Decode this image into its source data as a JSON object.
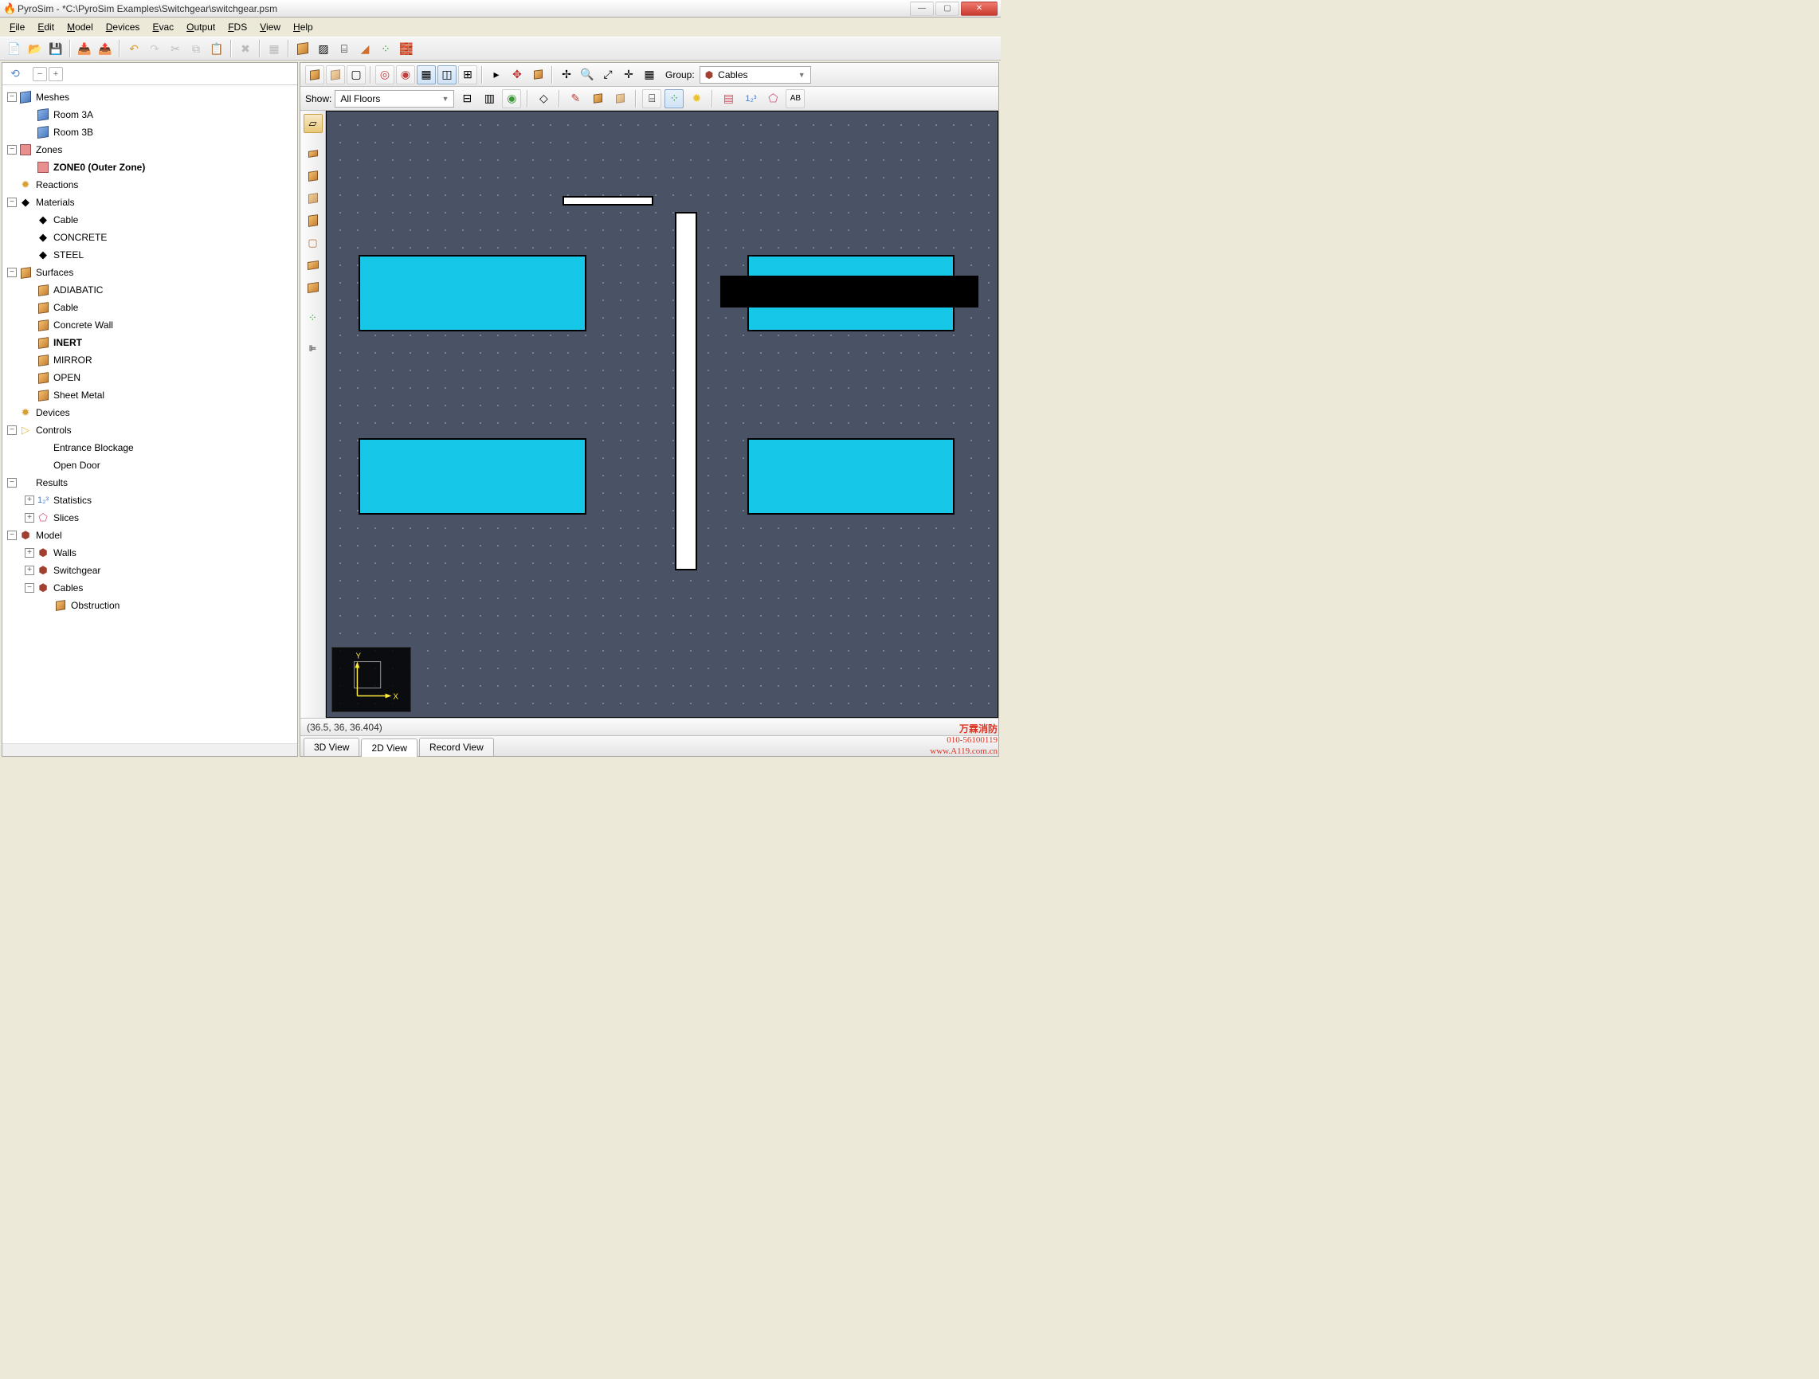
{
  "window": {
    "title": "PyroSim - *C:\\PyroSim Examples\\Switchgear\\switchgear.psm"
  },
  "menubar": [
    "File",
    "Edit",
    "Model",
    "Devices",
    "Evac",
    "Output",
    "FDS",
    "View",
    "Help"
  ],
  "group": {
    "label": "Group:",
    "value": "Cables"
  },
  "show": {
    "label": "Show:",
    "value": "All Floors"
  },
  "tree": [
    {
      "d": 0,
      "exp": "-",
      "icon": "mesh",
      "label": "Meshes"
    },
    {
      "d": 1,
      "exp": "",
      "icon": "mesh",
      "label": "Room 3A"
    },
    {
      "d": 1,
      "exp": "",
      "icon": "mesh",
      "label": "Room 3B"
    },
    {
      "d": 0,
      "exp": "-",
      "icon": "zone",
      "label": "Zones"
    },
    {
      "d": 1,
      "exp": "",
      "icon": "zone",
      "label": "ZONE0 (Outer Zone)",
      "bold": true
    },
    {
      "d": 0,
      "exp": "",
      "icon": "react",
      "label": "Reactions"
    },
    {
      "d": 0,
      "exp": "-",
      "icon": "mat",
      "label": "Materials"
    },
    {
      "d": 1,
      "exp": "",
      "icon": "mat",
      "label": "Cable"
    },
    {
      "d": 1,
      "exp": "",
      "icon": "mat",
      "label": "CONCRETE"
    },
    {
      "d": 1,
      "exp": "",
      "icon": "mat",
      "label": "STEEL"
    },
    {
      "d": 0,
      "exp": "-",
      "icon": "surf",
      "label": "Surfaces"
    },
    {
      "d": 1,
      "exp": "",
      "icon": "surf",
      "label": "ADIABATIC"
    },
    {
      "d": 1,
      "exp": "",
      "icon": "surf",
      "label": "Cable"
    },
    {
      "d": 1,
      "exp": "",
      "icon": "surf",
      "label": "Concrete Wall"
    },
    {
      "d": 1,
      "exp": "",
      "icon": "surf",
      "label": "INERT",
      "bold": true
    },
    {
      "d": 1,
      "exp": "",
      "icon": "surf",
      "label": "MIRROR"
    },
    {
      "d": 1,
      "exp": "",
      "icon": "surf",
      "label": "OPEN"
    },
    {
      "d": 1,
      "exp": "",
      "icon": "surf",
      "label": "Sheet Metal"
    },
    {
      "d": 0,
      "exp": "",
      "icon": "dev",
      "label": "Devices"
    },
    {
      "d": 0,
      "exp": "-",
      "icon": "ctrl",
      "label": "Controls"
    },
    {
      "d": 1,
      "exp": "",
      "icon": "none",
      "label": "Entrance Blockage"
    },
    {
      "d": 1,
      "exp": "",
      "icon": "none",
      "label": "Open Door"
    },
    {
      "d": 0,
      "exp": "-",
      "icon": "res",
      "label": "Results"
    },
    {
      "d": 1,
      "exp": "+",
      "icon": "stat",
      "label": "Statistics"
    },
    {
      "d": 1,
      "exp": "+",
      "icon": "slice",
      "label": "Slices"
    },
    {
      "d": 0,
      "exp": "-",
      "icon": "model",
      "label": "Model"
    },
    {
      "d": 1,
      "exp": "+",
      "icon": "model",
      "label": "Walls"
    },
    {
      "d": 1,
      "exp": "+",
      "icon": "model",
      "label": "Switchgear"
    },
    {
      "d": 1,
      "exp": "-",
      "icon": "model",
      "label": "Cables"
    },
    {
      "d": 2,
      "exp": "",
      "icon": "obst",
      "label": "Obstruction"
    }
  ],
  "status": {
    "coords": "(36.5, 36, 36.404)"
  },
  "viewtabs": [
    {
      "label": "3D View",
      "active": false
    },
    {
      "label": "2D View",
      "active": true
    },
    {
      "label": "Record View",
      "active": false
    }
  ],
  "watermark": {
    "l1": "万霖消防",
    "l2": "010-56100119",
    "l3": "www.A119.com.cn"
  },
  "axis": {
    "x": "X",
    "y": "Y"
  },
  "toolbar_icons": {
    "new": "📄",
    "open": "📂",
    "save": "💾",
    "import": "📥",
    "export": "📤",
    "undo": "↶",
    "redo": "↷",
    "cut": "✂",
    "copy": "⧉",
    "paste": "📋",
    "delete": "✖",
    "group": "▦",
    "box": "◫",
    "mesh": "▨",
    "props": "⌸",
    "paint": "◢",
    "dots": "⁘",
    "bricks": "🧱"
  }
}
